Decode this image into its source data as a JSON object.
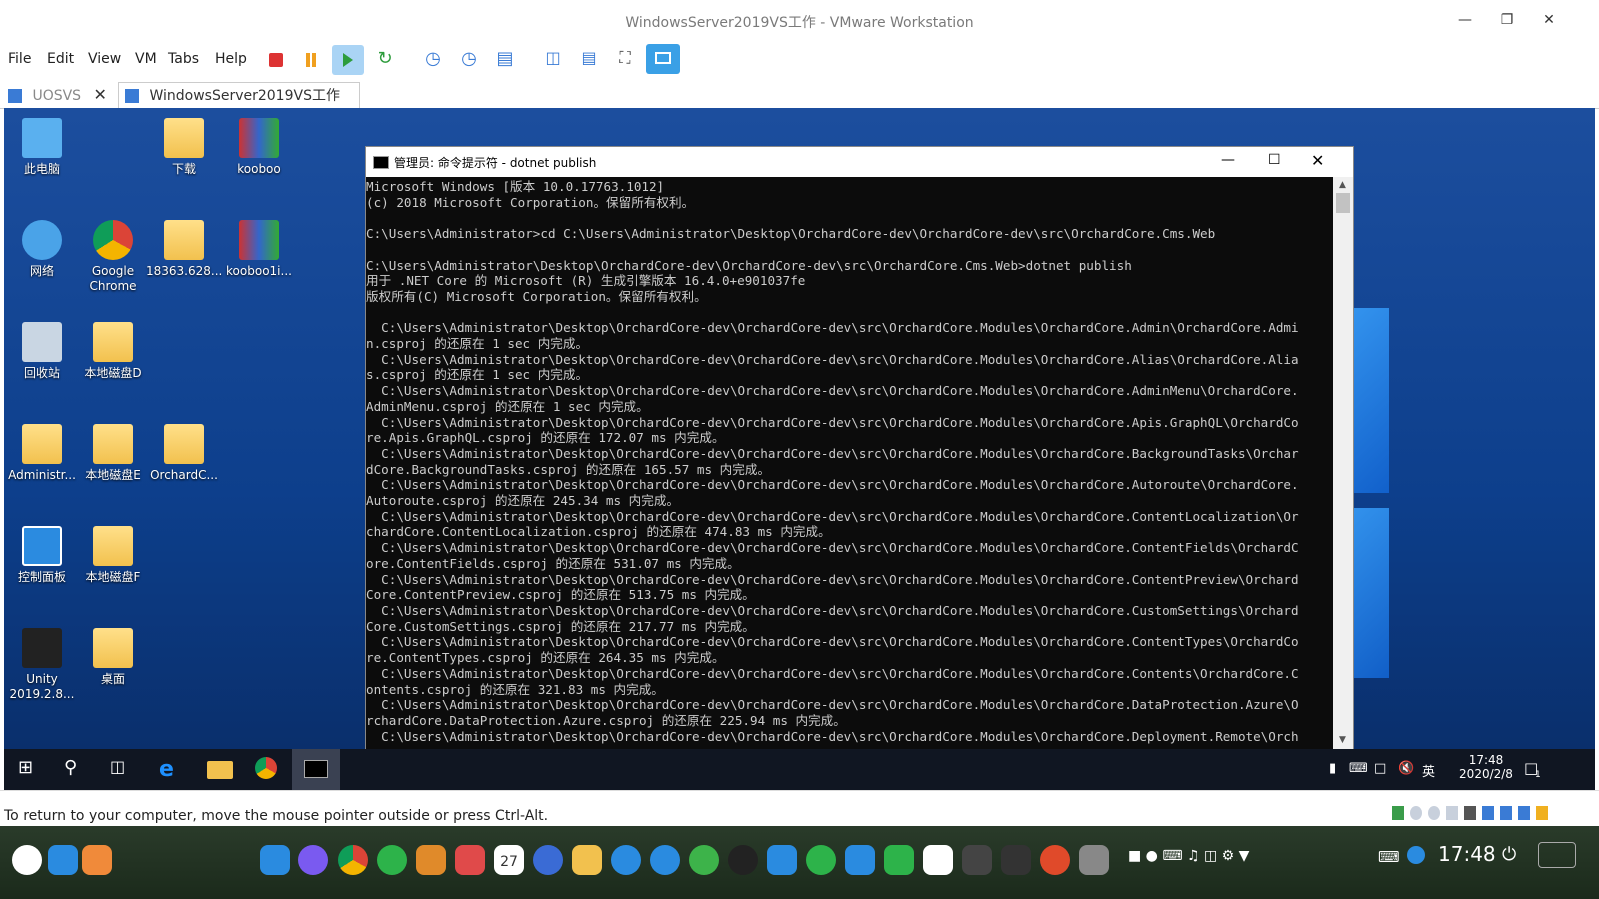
{
  "vmware": {
    "title": "WindowsServer2019VS工作 - VMware Workstation",
    "menu": [
      "File",
      "Edit",
      "View",
      "VM",
      "Tabs",
      "Help"
    ],
    "tabs": [
      {
        "label": "UOSVS"
      },
      {
        "label": "WindowsServer2019VS工作"
      }
    ],
    "status": "To return to your computer, move the mouse pointer outside or press Ctrl-Alt."
  },
  "desktop_icons": [
    {
      "label": "此电脑",
      "icon": "computer-icon"
    },
    {
      "label": "下载",
      "icon": "folder-icon"
    },
    {
      "label": "kooboo",
      "icon": "archive-icon"
    },
    {
      "label": "网络",
      "icon": "network-icon"
    },
    {
      "label": "Google Chrome",
      "icon": "chrome-icon"
    },
    {
      "label": "18363.628...",
      "icon": "folder-icon"
    },
    {
      "label": "kooboo1i...",
      "icon": "archive-icon"
    },
    {
      "label": "回收站",
      "icon": "recycle-bin-icon"
    },
    {
      "label": "本地磁盘D",
      "icon": "folder-icon"
    },
    {
      "label": "Administr...",
      "icon": "user-folder-icon"
    },
    {
      "label": "本地磁盘E",
      "icon": "folder-icon"
    },
    {
      "label": "OrchardC...",
      "icon": "folder-icon"
    },
    {
      "label": "控制面板",
      "icon": "control-panel-icon"
    },
    {
      "label": "本地磁盘F",
      "icon": "folder-icon"
    },
    {
      "label": "Unity 2019.2.8...",
      "icon": "unity-icon"
    },
    {
      "label": "桌面",
      "icon": "folder-icon"
    }
  ],
  "cmd": {
    "title": "管理员: 命令提示符 - dotnet  publish",
    "lines": [
      "Microsoft Windows [版本 10.0.17763.1012]",
      "(c) 2018 Microsoft Corporation。保留所有权利。",
      "",
      "C:\\Users\\Administrator>cd C:\\Users\\Administrator\\Desktop\\OrchardCore-dev\\OrchardCore-dev\\src\\OrchardCore.Cms.Web",
      "",
      "C:\\Users\\Administrator\\Desktop\\OrchardCore-dev\\OrchardCore-dev\\src\\OrchardCore.Cms.Web>dotnet publish",
      "用于 .NET Core 的 Microsoft (R) 生成引擎版本 16.4.0+e901037fe",
      "版权所有(C) Microsoft Corporation。保留所有权利。",
      "",
      "  C:\\Users\\Administrator\\Desktop\\OrchardCore-dev\\OrchardCore-dev\\src\\OrchardCore.Modules\\OrchardCore.Admin\\OrchardCore.Admi",
      "n.csproj 的还原在 1 sec 内完成。",
      "  C:\\Users\\Administrator\\Desktop\\OrchardCore-dev\\OrchardCore-dev\\src\\OrchardCore.Modules\\OrchardCore.Alias\\OrchardCore.Alia",
      "s.csproj 的还原在 1 sec 内完成。",
      "  C:\\Users\\Administrator\\Desktop\\OrchardCore-dev\\OrchardCore-dev\\src\\OrchardCore.Modules\\OrchardCore.AdminMenu\\OrchardCore.",
      "AdminMenu.csproj 的还原在 1 sec 内完成。",
      "  C:\\Users\\Administrator\\Desktop\\OrchardCore-dev\\OrchardCore-dev\\src\\OrchardCore.Modules\\OrchardCore.Apis.GraphQL\\OrchardCo",
      "re.Apis.GraphQL.csproj 的还原在 172.07 ms 内完成。",
      "  C:\\Users\\Administrator\\Desktop\\OrchardCore-dev\\OrchardCore-dev\\src\\OrchardCore.Modules\\OrchardCore.BackgroundTasks\\Orchar",
      "dCore.BackgroundTasks.csproj 的还原在 165.57 ms 内完成。",
      "  C:\\Users\\Administrator\\Desktop\\OrchardCore-dev\\OrchardCore-dev\\src\\OrchardCore.Modules\\OrchardCore.Autoroute\\OrchardCore.",
      "Autoroute.csproj 的还原在 245.34 ms 内完成。",
      "  C:\\Users\\Administrator\\Desktop\\OrchardCore-dev\\OrchardCore-dev\\src\\OrchardCore.Modules\\OrchardCore.ContentLocalization\\Or",
      "chardCore.ContentLocalization.csproj 的还原在 474.83 ms 内完成。",
      "  C:\\Users\\Administrator\\Desktop\\OrchardCore-dev\\OrchardCore-dev\\src\\OrchardCore.Modules\\OrchardCore.ContentFields\\OrchardC",
      "ore.ContentFields.csproj 的还原在 531.07 ms 内完成。",
      "  C:\\Users\\Administrator\\Desktop\\OrchardCore-dev\\OrchardCore-dev\\src\\OrchardCore.Modules\\OrchardCore.ContentPreview\\Orchard",
      "Core.ContentPreview.csproj 的还原在 513.75 ms 内完成。",
      "  C:\\Users\\Administrator\\Desktop\\OrchardCore-dev\\OrchardCore-dev\\src\\OrchardCore.Modules\\OrchardCore.CustomSettings\\Orchard",
      "Core.CustomSettings.csproj 的还原在 217.77 ms 内完成。",
      "  C:\\Users\\Administrator\\Desktop\\OrchardCore-dev\\OrchardCore-dev\\src\\OrchardCore.Modules\\OrchardCore.ContentTypes\\OrchardCo",
      "re.ContentTypes.csproj 的还原在 264.35 ms 内完成。",
      "  C:\\Users\\Administrator\\Desktop\\OrchardCore-dev\\OrchardCore-dev\\src\\OrchardCore.Modules\\OrchardCore.Contents\\OrchardCore.C",
      "ontents.csproj 的还原在 321.83 ms 内完成。",
      "  C:\\Users\\Administrator\\Desktop\\OrchardCore-dev\\OrchardCore-dev\\src\\OrchardCore.Modules\\OrchardCore.DataProtection.Azure\\O",
      "rchardCore.DataProtection.Azure.csproj 的还原在 225.94 ms 内完成。",
      "  C:\\Users\\Administrator\\Desktop\\OrchardCore-dev\\OrchardCore-dev\\src\\OrchardCore.Modules\\OrchardCore.Deployment.Remote\\Orch"
    ]
  },
  "taskbar": {
    "ime": "英",
    "time": "17:48",
    "date": "2020/2/8",
    "notifications": "1"
  },
  "host": {
    "time": "17:48",
    "calendar_day": "27"
  }
}
